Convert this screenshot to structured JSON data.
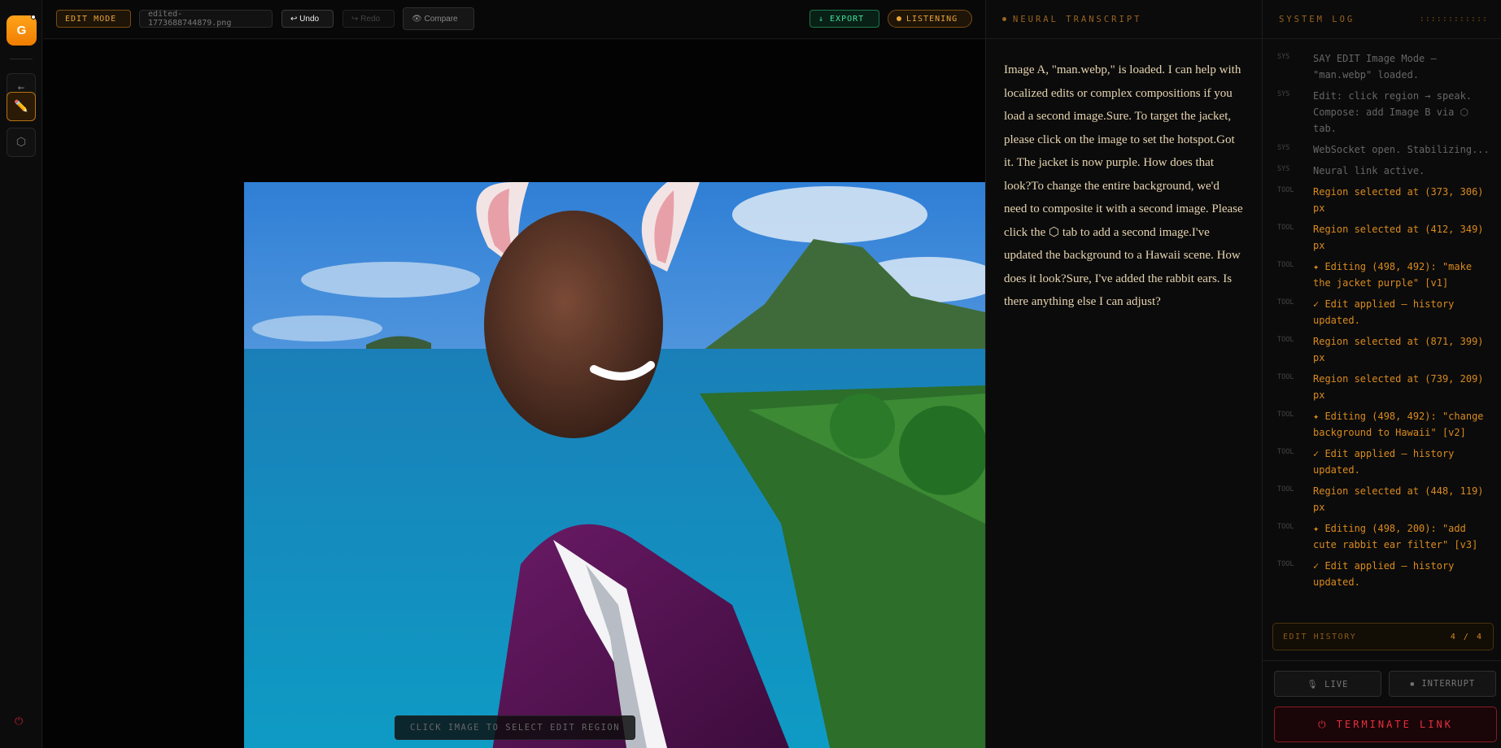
{
  "rail": {
    "logo_letter": "G",
    "back_icon": "←",
    "edit_icon": "✏️",
    "compose_icon": "⬡",
    "power_icon": "⏻"
  },
  "toolbar": {
    "mode": "EDIT MODE",
    "file": "edited-1773688744879.png",
    "undo": "↩ Undo",
    "redo": "↪ Redo",
    "compare": "👁 Compare",
    "export": "↓ EXPORT",
    "listening": "LISTENING"
  },
  "canvas": {
    "hint": "CLICK IMAGE TO SELECT EDIT REGION"
  },
  "transcript": {
    "title": "NEURAL TRANSCRIPT",
    "text": "Image A, \"man.webp,\" is loaded. I can help with localized edits or complex compositions if you load a second image.Sure. To target the jacket, please click on the image to set the hotspot.Got it. The jacket is now purple. How does that look?To change the entire background, we'd need to composite it with a second image. Please click the ⬡ tab to add a second image.I've updated the background to a Hawaii scene. How does it look?Sure, I've added the rabbit ears. Is there anything else I can adjust?"
  },
  "syslog": {
    "title": "SYSTEM LOG",
    "entries": [
      {
        "tag": "SYS",
        "text": "SAY EDIT Image Mode — \"man.webp\" loaded."
      },
      {
        "tag": "SYS",
        "text": "Edit: click region → speak. Compose: add Image B via ⬡ tab."
      },
      {
        "tag": "SYS",
        "text": "WebSocket open. Stabilizing..."
      },
      {
        "tag": "SYS",
        "text": "Neural link active."
      },
      {
        "tag": "TOOL",
        "text": "Region selected at (373, 306) px"
      },
      {
        "tag": "TOOL",
        "text": "Region selected at (412, 349) px"
      },
      {
        "tag": "TOOL",
        "text": "✦ Editing (498, 492): \"make the jacket purple\" [v1]"
      },
      {
        "tag": "TOOL",
        "text": "✓ Edit applied — history updated."
      },
      {
        "tag": "TOOL",
        "text": "Region selected at (871, 399) px"
      },
      {
        "tag": "TOOL",
        "text": "Region selected at (739, 209) px"
      },
      {
        "tag": "TOOL",
        "text": "✦ Editing (498, 492): \"change background to Hawaii\" [v2]"
      },
      {
        "tag": "TOOL",
        "text": "✓ Edit applied — history updated."
      },
      {
        "tag": "TOOL",
        "text": "Region selected at (448, 119) px"
      },
      {
        "tag": "TOOL",
        "text": "✦ Editing (498, 200): \"add cute rabbit ear filter\" [v3]"
      },
      {
        "tag": "TOOL",
        "text": "✓ Edit applied — history updated."
      }
    ],
    "history_label": "EDIT HISTORY",
    "history_count": "4 / 4",
    "live": "🎙 LIVE",
    "interrupt": "▪ INTERRUPT",
    "terminate": "⏻  TERMINATE LINK"
  }
}
